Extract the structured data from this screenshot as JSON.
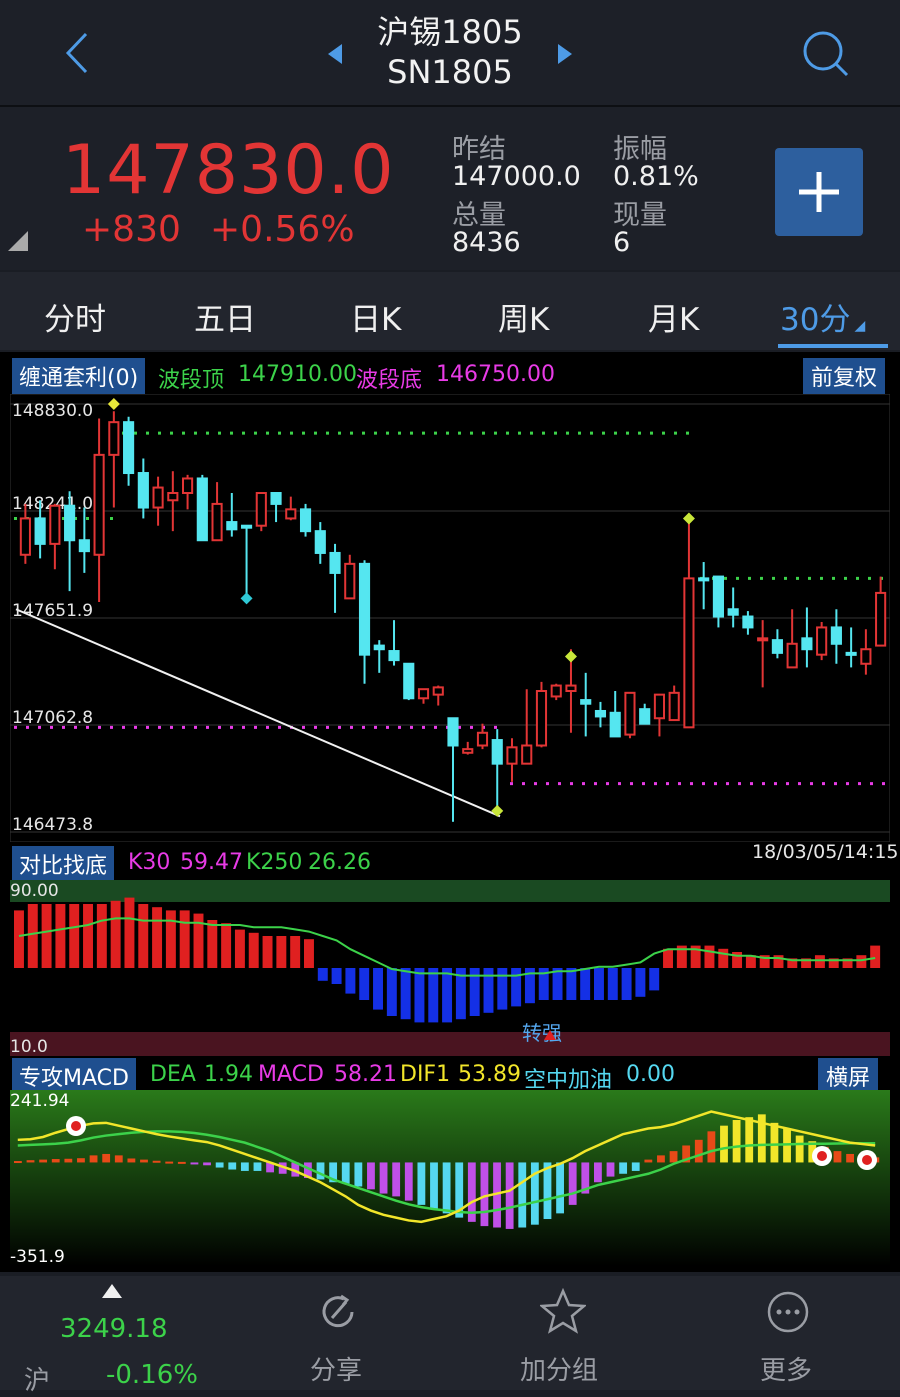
{
  "header": {
    "title": "沪锡1805",
    "code": "SN1805"
  },
  "quote": {
    "price": "147830.0",
    "change": "+830",
    "change_pct": "+0.56%",
    "prev_close_label": "昨结",
    "prev_close": "147000.0",
    "amplitude_label": "振幅",
    "amplitude": "0.81%",
    "volume_label": "总量",
    "volume": "8436",
    "current_vol_label": "现量",
    "current_vol": "6"
  },
  "tabs": [
    "分时",
    "五日",
    "日K",
    "周K",
    "月K",
    "30分"
  ],
  "active_tab": "30分",
  "main_indicator": {
    "name": "缠通套利(0)",
    "top_label": "波段顶",
    "top_value": "147910.00",
    "bottom_label": "波段底",
    "bottom_value": "146750.00",
    "adjust_button": "前复权",
    "y_ticks": [
      "148830.0",
      "148241.0",
      "147651.9",
      "147062.8",
      "146473.8"
    ],
    "timestamp": "18/03/05/14:15"
  },
  "ind2": {
    "name": "对比找底",
    "k30_label": "K30",
    "k30": "59.47",
    "k250_label": "K250",
    "k250": "26.26",
    "y_top": "90.00",
    "y_bottom": "10.0",
    "annotation": "转强"
  },
  "ind3": {
    "name": "专攻MACD",
    "dea_label": "DEA",
    "dea": "1.94",
    "macd_label": "MACD",
    "macd": "58.21",
    "dif1_label": "DIF1",
    "dif1": "53.89",
    "kzjy_label": "空中加油",
    "kzjy": "0.00",
    "landscape_button": "横屏",
    "y_top": "241.94",
    "y_bottom": "-351.9"
  },
  "bottom_nav": {
    "index_name": "沪",
    "index_value": "3249.18",
    "index_change": "-0.16%",
    "share": "分享",
    "add_group": "加分组",
    "more": "更多"
  },
  "colors": {
    "up": "#e23535",
    "down": "#55e6f0",
    "accent": "#4e9be6",
    "green": "#3cd24a",
    "magenta": "#e83be6"
  },
  "chart_data": [
    {
      "type": "candlestick",
      "ylim": [
        146473.8,
        148830.0
      ],
      "y_ticks": [
        148830.0,
        148241.0,
        147651.9,
        147062.8,
        146473.8
      ],
      "candles": [
        {
          "o": 148000,
          "h": 148280,
          "l": 147950,
          "c": 148200
        },
        {
          "o": 148200,
          "h": 148300,
          "l": 147980,
          "c": 148060
        },
        {
          "o": 148060,
          "h": 148280,
          "l": 147920,
          "c": 148270
        },
        {
          "o": 148270,
          "h": 148350,
          "l": 147800,
          "c": 148080
        },
        {
          "o": 148080,
          "h": 148260,
          "l": 147900,
          "c": 148020
        },
        {
          "o": 148000,
          "h": 148750,
          "l": 147740,
          "c": 148550
        },
        {
          "o": 148550,
          "h": 148790,
          "l": 148260,
          "c": 148730
        },
        {
          "o": 148730,
          "h": 148760,
          "l": 148380,
          "c": 148450
        },
        {
          "o": 148450,
          "h": 148530,
          "l": 148200,
          "c": 148260
        },
        {
          "o": 148260,
          "h": 148430,
          "l": 148160,
          "c": 148370
        },
        {
          "o": 148300,
          "h": 148460,
          "l": 148130,
          "c": 148340
        },
        {
          "o": 148340,
          "h": 148440,
          "l": 148250,
          "c": 148420
        },
        {
          "o": 148420,
          "h": 148440,
          "l": 148080,
          "c": 148080
        },
        {
          "o": 148080,
          "h": 148400,
          "l": 148160,
          "c": 148280
        },
        {
          "o": 148180,
          "h": 148340,
          "l": 148100,
          "c": 148140
        },
        {
          "o": 148160,
          "h": 148110,
          "l": 147780,
          "c": 148150
        },
        {
          "o": 148160,
          "h": 148310,
          "l": 148130,
          "c": 148340
        },
        {
          "o": 148340,
          "h": 148340,
          "l": 148180,
          "c": 148280
        },
        {
          "o": 148200,
          "h": 148320,
          "l": 148190,
          "c": 148250
        },
        {
          "o": 148250,
          "h": 148280,
          "l": 148100,
          "c": 148130
        },
        {
          "o": 148130,
          "h": 148180,
          "l": 147950,
          "c": 148010
        },
        {
          "o": 148010,
          "h": 148060,
          "l": 147680,
          "c": 147900
        },
        {
          "o": 147760,
          "h": 148000,
          "l": 147760,
          "c": 147950
        },
        {
          "o": 147950,
          "h": 147970,
          "l": 147290,
          "c": 147450
        },
        {
          "o": 147500,
          "h": 147530,
          "l": 147350,
          "c": 147480
        },
        {
          "o": 147470,
          "h": 147640,
          "l": 147390,
          "c": 147420
        },
        {
          "o": 147400,
          "h": 147390,
          "l": 147200,
          "c": 147210
        },
        {
          "o": 147210,
          "h": 147250,
          "l": 147180,
          "c": 147260
        },
        {
          "o": 147230,
          "h": 147280,
          "l": 147170,
          "c": 147270
        },
        {
          "o": 147100,
          "h": 147100,
          "l": 146530,
          "c": 146950
        },
        {
          "o": 146910,
          "h": 146970,
          "l": 146900,
          "c": 146930
        },
        {
          "o": 146950,
          "h": 147070,
          "l": 146930,
          "c": 147020
        },
        {
          "o": 146980,
          "h": 147040,
          "l": 146590,
          "c": 146850
        },
        {
          "o": 146850,
          "h": 146990,
          "l": 146750,
          "c": 146940
        },
        {
          "o": 146850,
          "h": 147260,
          "l": 146850,
          "c": 146950
        },
        {
          "o": 146950,
          "h": 147300,
          "l": 146940,
          "c": 147250
        },
        {
          "o": 147220,
          "h": 147290,
          "l": 147200,
          "c": 147280
        },
        {
          "o": 147250,
          "h": 147480,
          "l": 147020,
          "c": 147280
        },
        {
          "o": 147200,
          "h": 147350,
          "l": 147000,
          "c": 147180
        },
        {
          "o": 147140,
          "h": 147190,
          "l": 147050,
          "c": 147110
        },
        {
          "o": 147130,
          "h": 147250,
          "l": 147010,
          "c": 147000
        },
        {
          "o": 147010,
          "h": 147130,
          "l": 146990,
          "c": 147240
        },
        {
          "o": 147150,
          "h": 147180,
          "l": 147070,
          "c": 147070
        },
        {
          "o": 147100,
          "h": 147230,
          "l": 147000,
          "c": 147230
        },
        {
          "o": 147090,
          "h": 147280,
          "l": 147100,
          "c": 147240
        },
        {
          "o": 147050,
          "h": 148200,
          "l": 147050,
          "c": 147870
        },
        {
          "o": 147870,
          "h": 147960,
          "l": 147700,
          "c": 147860
        },
        {
          "o": 147880,
          "h": 147880,
          "l": 147600,
          "c": 147660
        },
        {
          "o": 147700,
          "h": 147820,
          "l": 147600,
          "c": 147670
        },
        {
          "o": 147660,
          "h": 147690,
          "l": 147560,
          "c": 147600
        },
        {
          "o": 147540,
          "h": 147640,
          "l": 147270,
          "c": 147540
        },
        {
          "o": 147530,
          "h": 147590,
          "l": 147430,
          "c": 147460
        },
        {
          "o": 147380,
          "h": 147700,
          "l": 147400,
          "c": 147510
        },
        {
          "o": 147540,
          "h": 147710,
          "l": 147380,
          "c": 147480
        },
        {
          "o": 147450,
          "h": 147630,
          "l": 147420,
          "c": 147600
        },
        {
          "o": 147600,
          "h": 147700,
          "l": 147400,
          "c": 147510
        },
        {
          "o": 147460,
          "h": 147600,
          "l": 147380,
          "c": 147450
        },
        {
          "o": 147400,
          "h": 147590,
          "l": 147340,
          "c": 147480
        },
        {
          "o": 147500,
          "h": 147880,
          "l": 147530,
          "c": 147790
        }
      ],
      "top_level": 148670,
      "bottom_level_left": 147050,
      "bottom_level_right": 146740,
      "mid_level_left": 148200,
      "right_top_level": 147870
    },
    {
      "type": "bar",
      "ylim": [
        10.0,
        90.0
      ],
      "bars": [
        18,
        20,
        20,
        20,
        20,
        20,
        20,
        21,
        22,
        20,
        19,
        18,
        18,
        17,
        15,
        14,
        12,
        11,
        10,
        10,
        10,
        9,
        -4,
        -5,
        -8,
        -10,
        -13,
        -15,
        -16,
        -17,
        -17,
        -17,
        -16,
        -15,
        -14,
        -13,
        -12,
        -11,
        -10,
        -10,
        -10,
        -10,
        -10,
        -10,
        -10,
        -9,
        -7,
        6,
        7,
        7,
        7,
        6,
        5,
        4,
        4,
        4,
        3,
        3,
        4,
        3,
        3,
        4,
        7
      ],
      "k30_line": [
        50,
        51,
        52,
        53,
        54,
        55,
        57,
        58,
        58,
        57,
        57,
        57,
        56,
        56,
        55,
        55,
        55,
        54,
        54,
        54,
        53,
        52,
        50,
        48,
        44,
        41,
        38,
        35,
        34,
        33,
        33,
        33,
        32,
        32,
        32,
        32,
        32,
        33,
        33,
        34,
        34,
        35,
        36,
        36,
        37,
        38,
        42,
        44,
        44,
        44,
        43,
        42,
        41,
        41,
        40,
        40,
        39,
        39,
        39,
        39,
        39,
        39,
        40
      ],
      "annotation": "转强"
    },
    {
      "type": "bar",
      "ylim": [
        -351.9,
        241.94
      ],
      "macd": [
        5,
        8,
        10,
        12,
        13,
        15,
        25,
        30,
        25,
        14,
        10,
        6,
        3,
        2,
        -5,
        -10,
        -18,
        -25,
        -30,
        -30,
        -35,
        -40,
        -50,
        -55,
        -60,
        -70,
        -75,
        -85,
        -95,
        -110,
        -120,
        -135,
        -150,
        -165,
        -180,
        -195,
        -210,
        -225,
        -230,
        -235,
        -230,
        -220,
        -200,
        -180,
        -150,
        -110,
        -70,
        -50,
        -40,
        -30,
        10,
        25,
        40,
        60,
        80,
        110,
        130,
        150,
        160,
        170,
        140,
        120,
        95,
        75,
        55,
        40,
        30,
        25,
        18
      ],
      "dif_line": [
        80,
        82,
        90,
        105,
        118,
        130,
        138,
        140,
        130,
        120,
        110,
        100,
        92,
        85,
        78,
        72,
        60,
        45,
        30,
        15,
        0,
        -15,
        -30,
        -50,
        -70,
        -95,
        -120,
        -150,
        -170,
        -185,
        -195,
        -205,
        -210,
        -200,
        -190,
        -170,
        -140,
        -120,
        -110,
        -100,
        -70,
        -40,
        -20,
        -5,
        15,
        40,
        60,
        80,
        100,
        110,
        120,
        125,
        135,
        150,
        165,
        180,
        170,
        160,
        150,
        140,
        130,
        120,
        110,
        100,
        90,
        80,
        70,
        65,
        60
      ],
      "dea_line": [
        60,
        62,
        64,
        66,
        70,
        78,
        88,
        95,
        100,
        105,
        108,
        110,
        110,
        108,
        104,
        98,
        90,
        80,
        70,
        55,
        40,
        20,
        0,
        -20,
        -40,
        -60,
        -75,
        -90,
        -105,
        -120,
        -135,
        -148,
        -158,
        -165,
        -170,
        -175,
        -178,
        -175,
        -168,
        -160,
        -150,
        -140,
        -130,
        -120,
        -110,
        -95,
        -80,
        -70,
        -60,
        -50,
        -40,
        -25,
        -5,
        10,
        25,
        40,
        50,
        56,
        60,
        62,
        63,
        64,
        65,
        66,
        66,
        67,
        68,
        68,
        68
      ]
    }
  ]
}
